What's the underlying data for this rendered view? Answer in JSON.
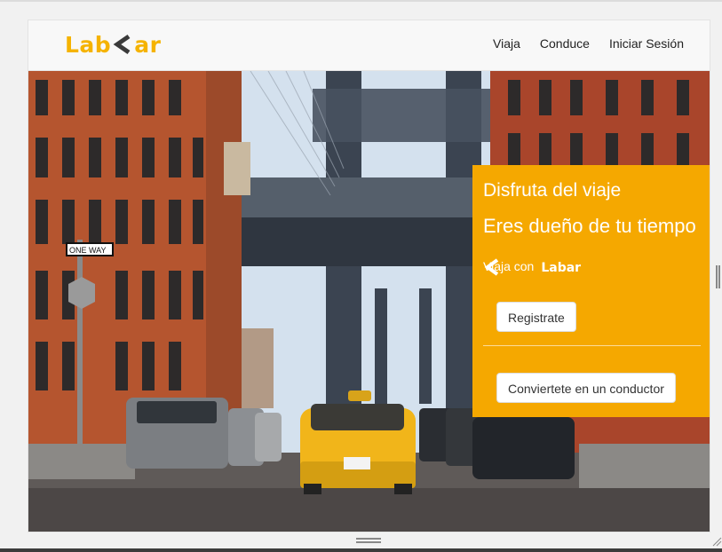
{
  "brand": {
    "left": "Lab",
    "right": "ar",
    "color": "#f5b301"
  },
  "nav": {
    "items": [
      "Viaja",
      "Conduce",
      "Iniciar Sesión"
    ]
  },
  "hero": {
    "headline_1": "Disfruta del viaje",
    "headline_2": "Eres dueño de tu tiempo",
    "viaja_con": "Viaja con",
    "brand_left": "Lab",
    "brand_right": "ar",
    "register_button": "Registrate",
    "driver_button": "Conviertete en un conductor",
    "card_color": "#f5a800"
  },
  "street_sign": {
    "text": "ONE WAY"
  },
  "icons": [
    "chevron-left-icon",
    "resize-handle-icon"
  ]
}
